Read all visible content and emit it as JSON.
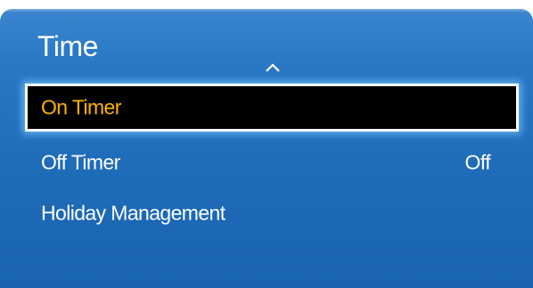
{
  "menu": {
    "title": "Time",
    "items": [
      {
        "label": "On Timer",
        "value": "",
        "selected": true
      },
      {
        "label": "Off Timer",
        "value": "Off",
        "selected": false
      },
      {
        "label": "Holiday Management",
        "value": "",
        "selected": false
      }
    ]
  },
  "icons": {
    "scroll_up": "chevron-up-icon"
  },
  "colors": {
    "panel_blue": "#1f6cb9",
    "selected_text": "#ffb300",
    "selected_bg": "#000000",
    "text": "#ffffff"
  }
}
